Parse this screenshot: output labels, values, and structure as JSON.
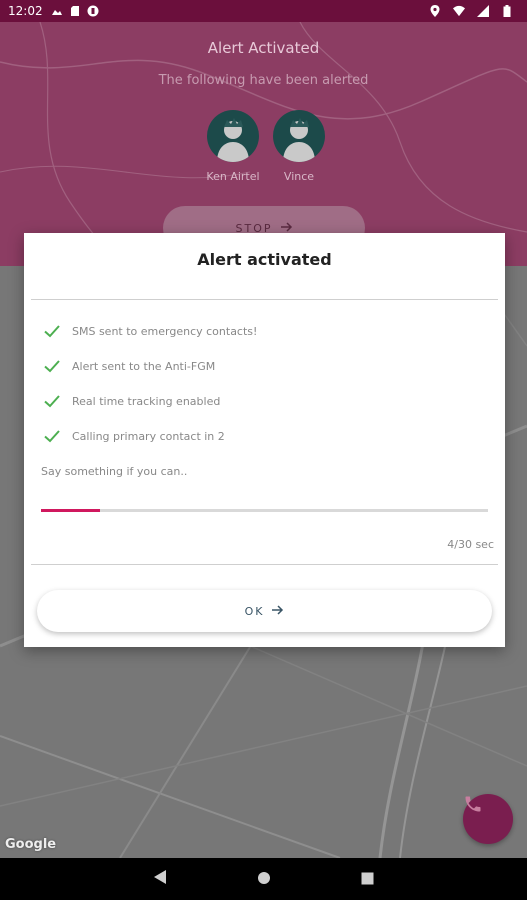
{
  "status_bar": {
    "time": "12:02"
  },
  "header": {
    "title": "Alert Activated",
    "subtitle": "The following have been alerted",
    "contacts": [
      {
        "name": "Ken Airtel"
      },
      {
        "name": "Vince"
      }
    ],
    "stop_label": "STOP"
  },
  "dialog": {
    "title": "Alert activated",
    "items": [
      "SMS sent to emergency contacts!",
      "Alert sent to the Anti-FGM",
      "Real time tracking enabled",
      "Calling primary contact in 2"
    ],
    "prompt": "Say something if you can..",
    "progress_fraction": 0.133,
    "timer": "4/30 sec",
    "ok_label": "OK"
  },
  "map": {
    "attribution": "Google"
  },
  "colors": {
    "accent": "#d0185e",
    "check": "#4caf50",
    "header": "#8c3d63",
    "status_bar": "#6b0f3c",
    "fab": "#7a1e4f"
  },
  "icons": {
    "status": [
      "photos-icon",
      "sd-card-icon",
      "app-icon",
      "location-icon",
      "wifi-icon",
      "signal-icon",
      "battery-icon"
    ],
    "fab": "phone-icon",
    "nav": [
      "back-icon",
      "home-icon",
      "recents-icon"
    ]
  }
}
